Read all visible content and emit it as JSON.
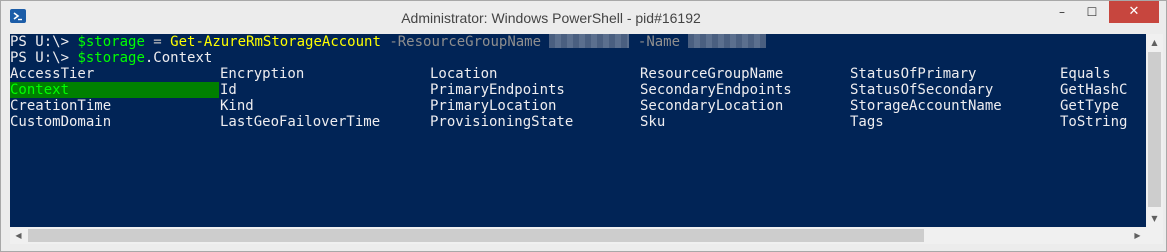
{
  "window": {
    "title": "Administrator: Windows PowerShell - pid#16192",
    "icon": "powershell-icon",
    "buttons": {
      "minimize": "–",
      "maximize": "☐",
      "close": "✕"
    }
  },
  "console": {
    "line1": {
      "prompt": "PS U:\\> ",
      "variable": "$storage",
      "operator": " = ",
      "command": "Get-AzureRmStorageAccount",
      "param1": " -ResourceGroupName ",
      "param2": " -Name "
    },
    "line2": {
      "prompt": "PS U:\\> ",
      "variable": "$storage",
      "member": ".Context"
    },
    "completion_columns": [
      [
        "AccessTier",
        "Context",
        "CreationTime",
        "CustomDomain"
      ],
      [
        "Encryption",
        "Id",
        "Kind",
        "LastGeoFailoverTime"
      ],
      [
        "Location",
        "PrimaryEndpoints",
        "PrimaryLocation",
        "ProvisioningState"
      ],
      [
        "ResourceGroupName",
        "SecondaryEndpoints",
        "SecondaryLocation",
        "Sku"
      ],
      [
        "StatusOfPrimary",
        "StatusOfSecondary",
        "StorageAccountName",
        "Tags"
      ],
      [
        "Equals",
        "GetHashC",
        "GetType",
        "ToString"
      ]
    ],
    "selected_item": "Context"
  },
  "colors": {
    "console_bg": "#012456",
    "selection_bg": "#008000",
    "variable": "#00ff00",
    "command": "#ffff00"
  }
}
